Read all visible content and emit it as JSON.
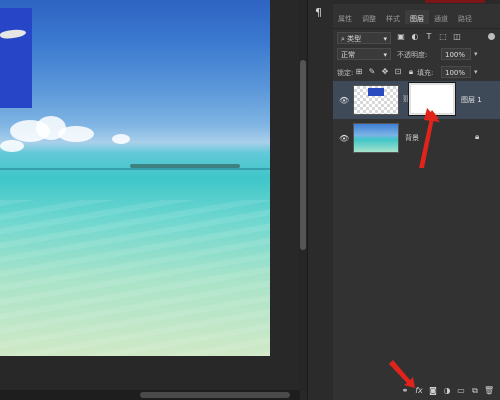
{
  "dock": {
    "panel_icon": "¶"
  },
  "panel": {
    "tabs": [
      "属性",
      "调整",
      "样式",
      "图层",
      "通道",
      "路径"
    ],
    "active_tab_index": 3,
    "filter": {
      "kind": "类型",
      "kind_icon": "search-icon"
    },
    "blend_mode": "正常",
    "opacity_label": "不透明度:",
    "opacity_value": "100%",
    "lock_label": "锁定:",
    "fill_label": "填充:",
    "fill_value": "100%",
    "layers": [
      {
        "name": "图层 1",
        "selected": true,
        "has_mask": true
      },
      {
        "name": "背景",
        "selected": false,
        "locked": true
      }
    ],
    "bottom_icons": [
      "link-layers-icon",
      "fx-icon",
      "add-mask-icon",
      "adjustment-layer-icon",
      "new-group-icon",
      "new-layer-icon",
      "delete-icon"
    ],
    "fx_label": "fx"
  },
  "colors": {
    "accent_arrow": "#e0241b",
    "panel_bg": "#323232",
    "selected_layer": "#3f4a59"
  }
}
